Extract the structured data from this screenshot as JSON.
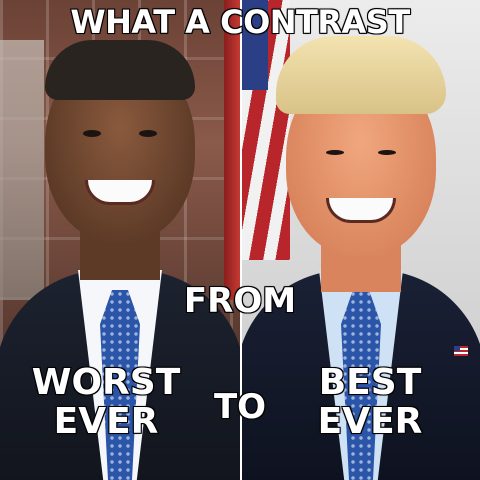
{
  "meme": {
    "headline": "WHAT A CONTRAST",
    "from_label": "FROM",
    "left_caption": {
      "line1": "WORST",
      "line2": "EVER"
    },
    "connector_label": "TO",
    "right_caption": {
      "line1": "BEST",
      "line2": "EVER"
    }
  },
  "colors": {
    "caption_fill": "#ffffff",
    "caption_stroke": "#000000",
    "left_tie": "#2b55a8",
    "right_tie": "#2b55a8"
  }
}
